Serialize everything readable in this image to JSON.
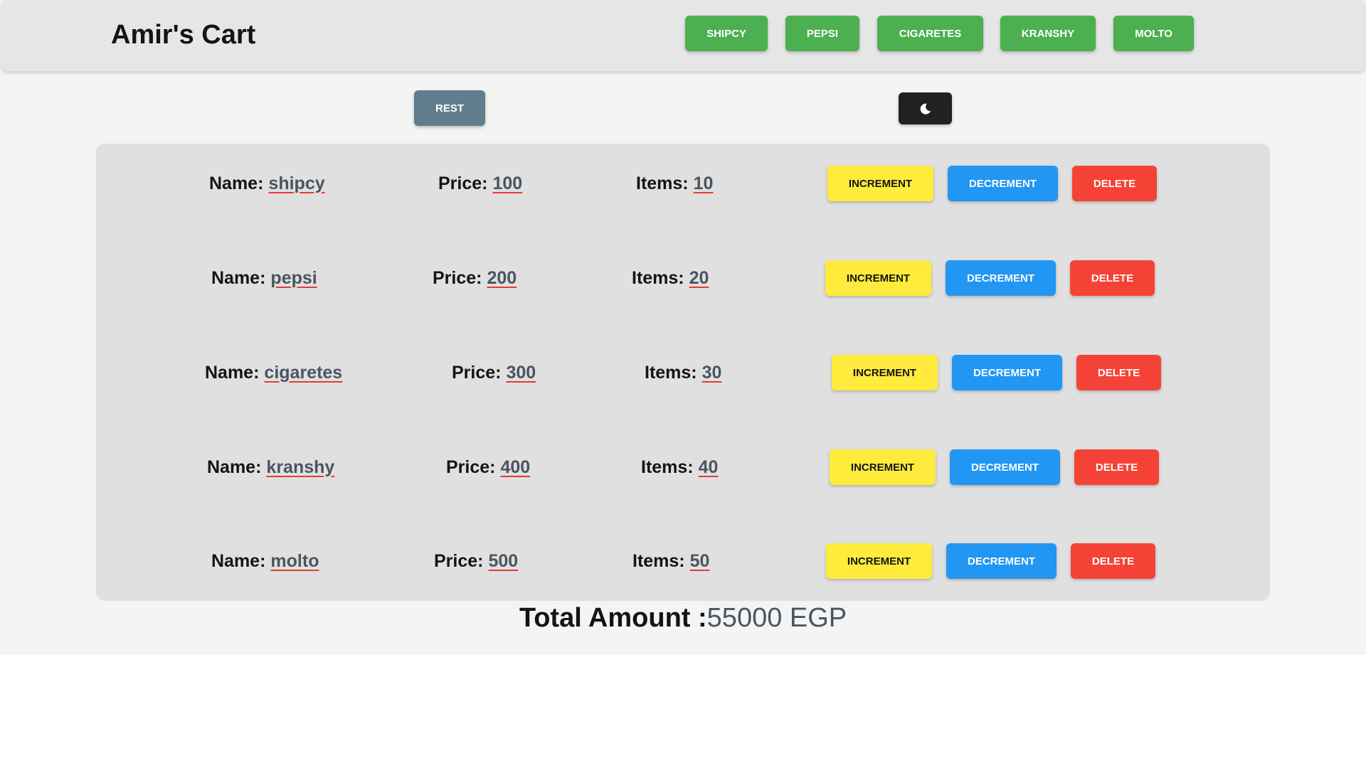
{
  "app": {
    "title": "Amir's Cart"
  },
  "nav": {
    "buttons": [
      "SHIPCY",
      "PEPSI",
      "CIGARETES",
      "KRANSHY",
      "MOLTO"
    ]
  },
  "controls": {
    "reset_label": "REST",
    "theme_icon": "moon-icon"
  },
  "cart": {
    "labels": {
      "name": "Name:",
      "price": "Price:",
      "items": "Items:"
    },
    "actions": {
      "increment": "INCREMENT",
      "decrement": "DECREMENT",
      "delete": "DELETE"
    },
    "products": [
      {
        "name": "shipcy",
        "price": "100",
        "items": "10"
      },
      {
        "name": "pepsi",
        "price": "200",
        "items": "20"
      },
      {
        "name": "cigaretes",
        "price": "300",
        "items": "30"
      },
      {
        "name": "kranshy",
        "price": "400",
        "items": "40"
      },
      {
        "name": "molto",
        "price": "500",
        "items": "50"
      }
    ]
  },
  "total": {
    "label": "Total Amount :",
    "value": "55000 EGP"
  },
  "colors": {
    "nav_button": "#4caf50",
    "reset_button": "#607d8b",
    "theme_button": "#212121",
    "increment": "#ffeb3b",
    "decrement": "#2196f3",
    "delete": "#f44336",
    "value_underline": "#e53935"
  }
}
